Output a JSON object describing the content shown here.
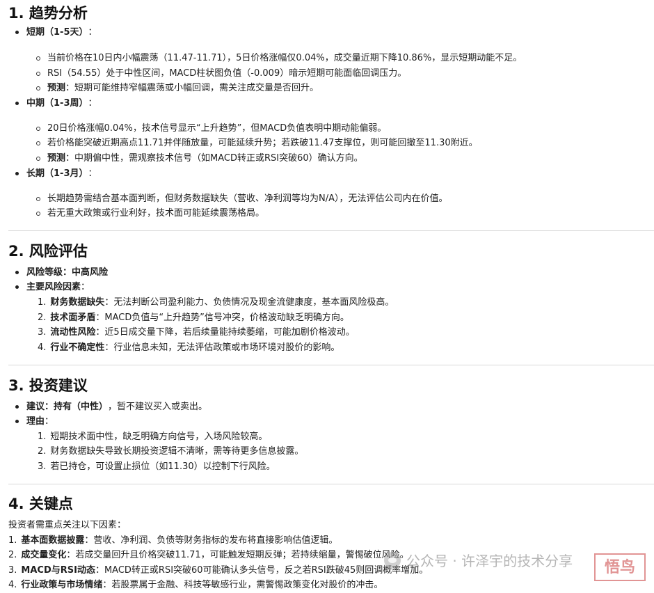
{
  "sections": [
    {
      "title": "1. 趋势分析",
      "groups": [
        {
          "label": "短期（1-5天）",
          "suffix": "：",
          "items": [
            {
              "text": "当前价格在10日内小幅震荡（11.47-11.71），5日价格涨幅仅0.04%，成交量近期下降10.86%，显示短期动能不足。"
            },
            {
              "text": "RSI（54.55）处于中性区间，MACD柱状图负值（-0.009）暗示短期可能面临回调压力。"
            },
            {
              "bold": "预测",
              "text": "：短期可能维持窄幅震荡或小幅回调，需关注成交量是否回升。"
            }
          ]
        },
        {
          "label": "中期（1-3周）",
          "suffix": "：",
          "items": [
            {
              "text": "20日价格涨幅0.04%，技术信号显示“上升趋势”，但MACD负值表明中期动能偏弱。"
            },
            {
              "text": "若价格能突破近期高点11.71并伴随放量，可能延续升势；若跌破11.47支撑位，则可能回撤至11.30附近。"
            },
            {
              "bold": "预测",
              "text": "：中期偏中性，需观察技术信号（如MACD转正或RSI突破60）确认方向。"
            }
          ]
        },
        {
          "label": "长期（1-3月）",
          "suffix": "：",
          "items": [
            {
              "text": "长期趋势需结合基本面判断，但财务数据缺失（营收、净利润等均为N/A），无法评估公司内在价值。"
            },
            {
              "text": "若无重大政策或行业利好，技术面可能延续震荡格局。"
            }
          ]
        }
      ]
    },
    {
      "title": "2. 风险评估",
      "bullets": [
        {
          "bold": "风险等级：中高风险",
          "text": ""
        },
        {
          "bold": "主要风险因素",
          "text": "："
        }
      ],
      "numbered": [
        {
          "n": "1.",
          "bold": "财务数据缺失",
          "text": "：无法判断公司盈利能力、负债情况及现金流健康度，基本面风险极高。"
        },
        {
          "n": "2.",
          "bold": "技术面矛盾",
          "text": "：MACD负值与“上升趋势”信号冲突，价格波动缺乏明确方向。"
        },
        {
          "n": "3.",
          "bold": "流动性风险",
          "text": "：近5日成交量下降，若后续量能持续萎缩，可能加剧价格波动。"
        },
        {
          "n": "4.",
          "bold": "行业不确定性",
          "text": "：行业信息未知，无法评估政策或市场环境对股价的影响。"
        }
      ]
    },
    {
      "title": "3. 投资建议",
      "bullets": [
        {
          "bold": "建议：持有（中性）",
          "text": "，暂不建议买入或卖出。"
        },
        {
          "bold": "理由",
          "text": "："
        }
      ],
      "numbered": [
        {
          "n": "1.",
          "bold": "",
          "text": "短期技术面中性，缺乏明确方向信号，入场风险较高。"
        },
        {
          "n": "2.",
          "bold": "",
          "text": "财务数据缺失导致长期投资逻辑不清晰，需等待更多信息披露。"
        },
        {
          "n": "3.",
          "bold": "",
          "text": "若已持仓，可设置止损位（如11.30）以控制下行风险。"
        }
      ]
    },
    {
      "title": "4. 关键点",
      "intro": "投资者需重点关注以下因素：",
      "numbered": [
        {
          "n": "1.",
          "bold": "基本面数据披露",
          "text": "：营收、净利润、负债等财务指标的发布将直接影响估值逻辑。"
        },
        {
          "n": "2.",
          "bold": "成交量变化",
          "text": "：若成交量回升且价格突破11.71，可能触发短期反弹；若持续缩量，警惕破位风险。"
        },
        {
          "n": "3.",
          "bold": "MACD与RSI动态",
          "text": "：MACD转正或RSI突破60可能确认多头信号，反之若RSI跌破45则回调概率增加。"
        },
        {
          "n": "4.",
          "bold": "行业政策与市场情绪",
          "text": "：若股票属于金融、科技等敏感行业，需警惕政策变化对股价的冲击。"
        }
      ]
    }
  ],
  "watermark": {
    "text": "公众号 · 许泽宇的技术分享",
    "stamp": "悟鸟"
  }
}
